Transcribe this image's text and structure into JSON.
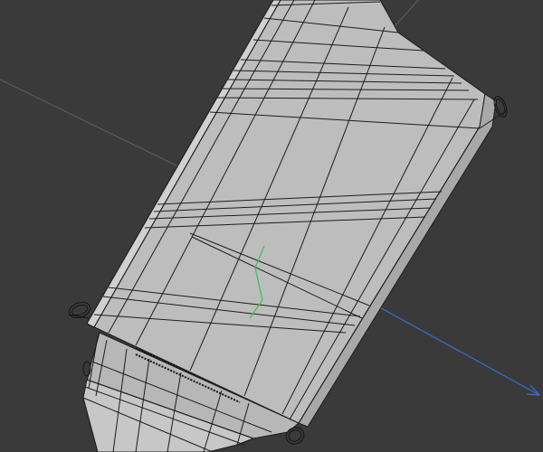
{
  "viewport": {
    "background": "#3a3a3a",
    "grid_color": "#606060"
  },
  "model": {
    "fill": "#bdbdbd",
    "face_light": "#c6c6c6",
    "face_dark": "#adadad",
    "wire": "#1c1c1c"
  },
  "axes": {
    "x_color": "#d63a3a",
    "y_color": "#36c25a",
    "z_color": "#3a6fd6"
  },
  "icons": [
    "wheel-icon"
  ]
}
